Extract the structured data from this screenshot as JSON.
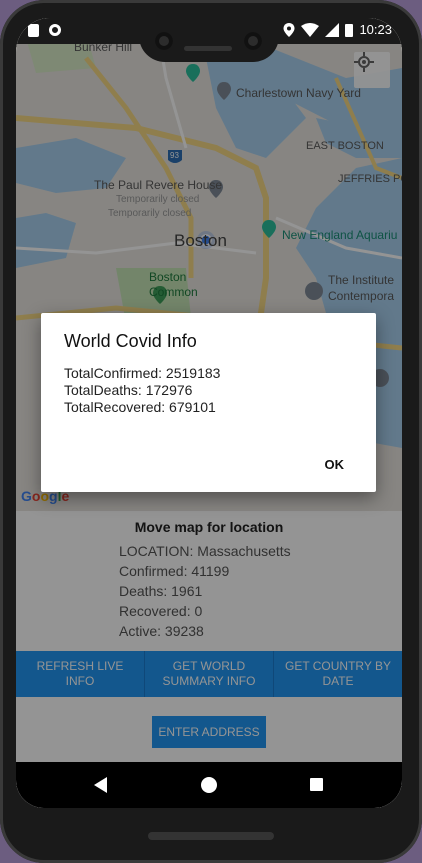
{
  "status_bar": {
    "time": "10:23"
  },
  "map": {
    "labels": {
      "bunker_hill": "Bunker Hill",
      "charlestown_navy_yard": "Charlestown Navy Yard",
      "east_boston": "EAST BOSTON",
      "jeffries_point": "JEFFRIES PO",
      "paul_revere_house": "The Paul Revere House",
      "temporarily_closed_1": "Temporarily closed",
      "temporarily_closed_2": "Temporarily closed",
      "boston": "Boston",
      "new_england_aquarium": "New England Aquariu",
      "boston_common": "Boston\nCommon",
      "the_institute": "The Institute",
      "contemporary": "Contempora",
      "route_93": "93"
    },
    "google": "Google",
    "colors": {
      "water": "#a9d1f0",
      "park": "#c6e5b7",
      "road": "#f6da85",
      "land": "#e8e6e1"
    }
  },
  "panel": {
    "move_label": "Move map for location",
    "location": "LOCATION: Massachusetts",
    "confirmed": "Confirmed: 41199",
    "deaths": "Deaths: 1961",
    "recovered": "Recovered: 0",
    "active": "Active: 39238",
    "buttons": {
      "refresh": "REFRESH LIVE INFO",
      "world_summary": "GET WORLD SUMMARY INFO",
      "country_by_date": "GET COUNTRY BY DATE",
      "enter_address": "ENTER ADDRESS"
    }
  },
  "dialog": {
    "title": "World Covid Info",
    "total_confirmed": "TotalConfirmed: 2519183",
    "total_deaths": "TotalDeaths: 172976",
    "total_recovered": "TotalRecovered: 679101",
    "ok": "OK"
  }
}
